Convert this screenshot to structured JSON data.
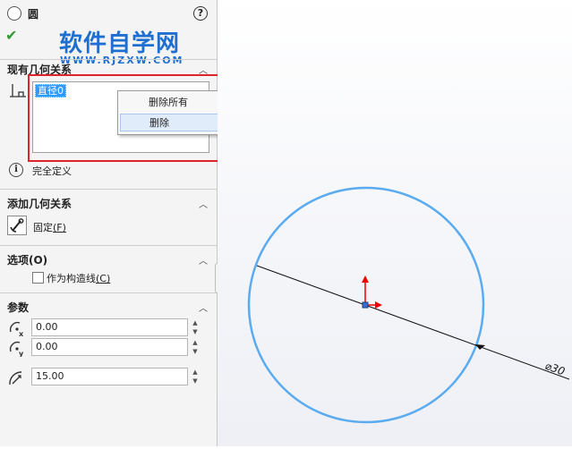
{
  "header": {
    "title": "圆",
    "help": "?"
  },
  "watermark": {
    "cn": "软件自学网",
    "url": "WWW.RJZXW.COM"
  },
  "existing_relations": {
    "title": "现有几何关系",
    "items": [
      "直径0"
    ],
    "context_menu": [
      "删除所有",
      "删除"
    ],
    "status": "完全定义"
  },
  "add_relations": {
    "title": "添加几何关系",
    "fix_label": "固定",
    "fix_key": "(F)"
  },
  "options": {
    "title": "选项(O)",
    "construction_label": "作为构造线",
    "construction_key": "(C)",
    "construction_checked": false
  },
  "params": {
    "title": "参数",
    "cx": "0.00",
    "cy": "0.00",
    "radius": "15.00"
  },
  "sketch": {
    "dimension_label": "⌀30"
  },
  "colors": {
    "accent": "#1e6fd0",
    "highlight": "#e0242a",
    "circle": "#5aabf0"
  }
}
